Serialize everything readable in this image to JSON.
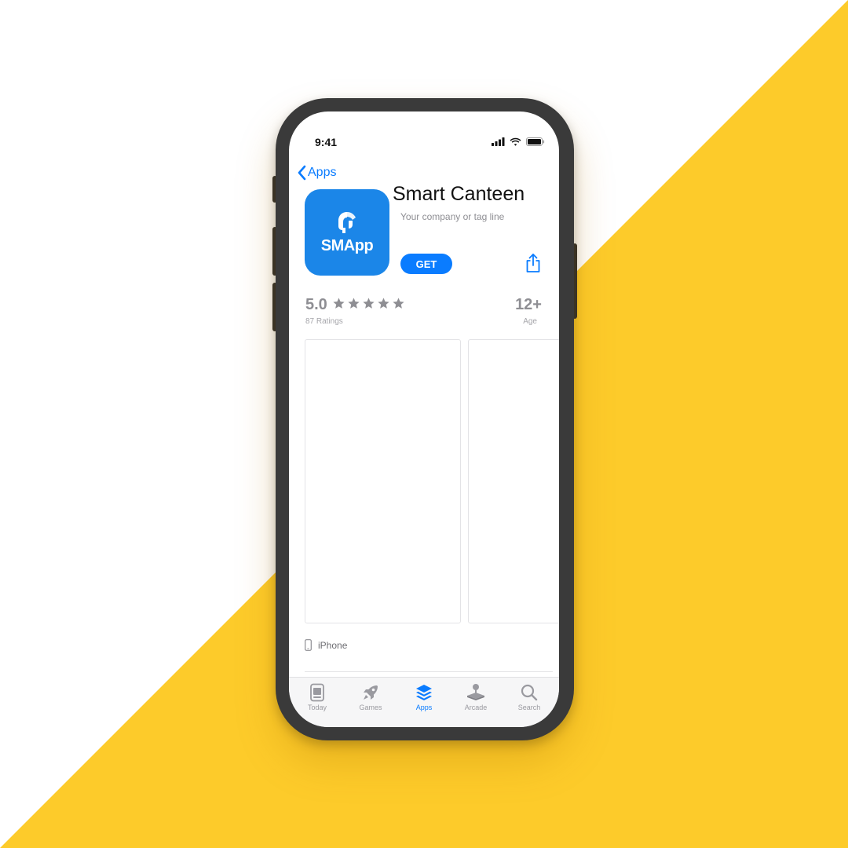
{
  "colors": {
    "background_white": "#ffffff",
    "background_yellow": "#fdcb2a",
    "phone_frame": "#3a3a3a",
    "accent_blue": "#0a7cff",
    "app_icon_blue": "#1b86e8",
    "secondary_gray": "#8e8e93"
  },
  "status_bar": {
    "time": "9:41",
    "icons": [
      "signal-icon",
      "wifi-icon",
      "battery-icon"
    ]
  },
  "nav": {
    "back_label": "Apps",
    "back_icon": "chevron-left-icon"
  },
  "app": {
    "icon_label": "SMApp",
    "icon_symbol": "spartan-helmet-icon",
    "title": "Smart Canteen",
    "tagline": "Your company or tag line",
    "get_label": "GET",
    "share_icon": "share-icon"
  },
  "ratings": {
    "value": "5.0",
    "stars": 5,
    "count_label": "87 Ratings",
    "age_value": "12+",
    "age_label": "Age"
  },
  "device": {
    "label": "iPhone",
    "icon": "iphone-icon"
  },
  "tabs": [
    {
      "label": "Today",
      "icon": "today-icon",
      "active": false
    },
    {
      "label": "Games",
      "icon": "rocket-icon",
      "active": false
    },
    {
      "label": "Apps",
      "icon": "layers-icon",
      "active": true
    },
    {
      "label": "Arcade",
      "icon": "joystick-icon",
      "active": false
    },
    {
      "label": "Search",
      "icon": "search-icon",
      "active": false
    }
  ]
}
